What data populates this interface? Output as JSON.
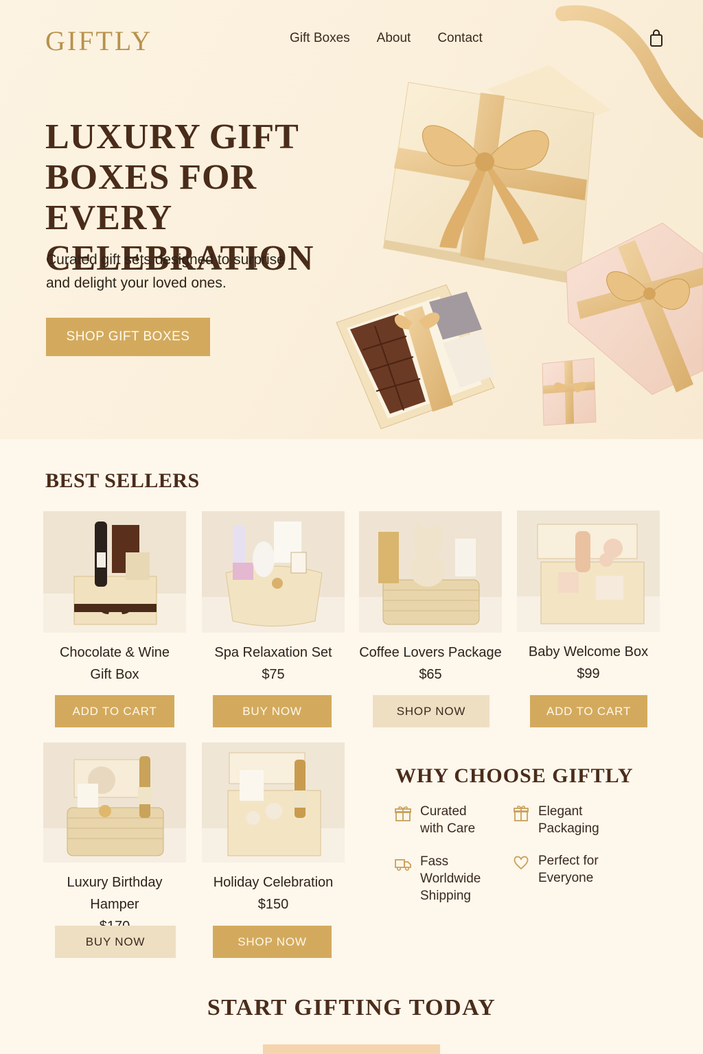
{
  "brand": {
    "logo": "GIFTLY"
  },
  "nav": {
    "items": [
      "Gift Boxes",
      "About",
      "Contact"
    ],
    "cart_icon": "shopping-bag-icon"
  },
  "hero": {
    "title_lines": [
      "LUXURY GIFT",
      "BOXES FOR EVERY",
      "CELEBRATION"
    ],
    "subtitle_lines": [
      "Curated gift sets designed to surprise",
      "and delight your loved ones."
    ],
    "cta": "SHOP GIFT BOXES"
  },
  "best_sellers": {
    "title": "BEST SELLERS",
    "products": [
      {
        "name_lines": [
          "Chocolate & Wine",
          "Gift Box"
        ],
        "price": "",
        "button": "ADD TO CART",
        "style": "gold"
      },
      {
        "name_lines": [
          "Spa Relaxation Set"
        ],
        "price": "$75",
        "button": "BUY NOW",
        "style": "gold"
      },
      {
        "name_lines": [
          "Coffee Lovers Package"
        ],
        "price": "$65",
        "button": "SHOP NOW",
        "style": "light"
      },
      {
        "name_lines": [
          "Baby Welcome Box"
        ],
        "price": "$99",
        "button": "ADD TO CART",
        "style": "gold"
      },
      {
        "name_lines": [
          "Luxury Birthday Hamper"
        ],
        "price": "$170",
        "button": "BUY NOW",
        "style": "light"
      },
      {
        "name_lines": [
          "Holiday Celebration"
        ],
        "price": "$150",
        "button": "SHOP NOW",
        "style": "gold"
      }
    ]
  },
  "why": {
    "title": "WHY CHOOSE GIFTLY",
    "features": [
      {
        "icon": "gift-box-icon",
        "lines": [
          "Curated",
          "with Care"
        ]
      },
      {
        "icon": "gift-icon",
        "lines": [
          "Elegant",
          "Packaging"
        ]
      },
      {
        "icon": "delivery-truck-icon",
        "lines": [
          "Fass",
          "Worldwide",
          "Shipping"
        ]
      },
      {
        "icon": "heart-icon",
        "lines": [
          "Perfect for",
          "Everyone"
        ]
      }
    ]
  },
  "cta": {
    "title": "START GIFTING TODAY",
    "button": ""
  },
  "colors": {
    "accent": "#d3aa5d",
    "accent_light": "#eedfc2",
    "background": "#fdf7ec",
    "heading": "#4a2c1a"
  }
}
